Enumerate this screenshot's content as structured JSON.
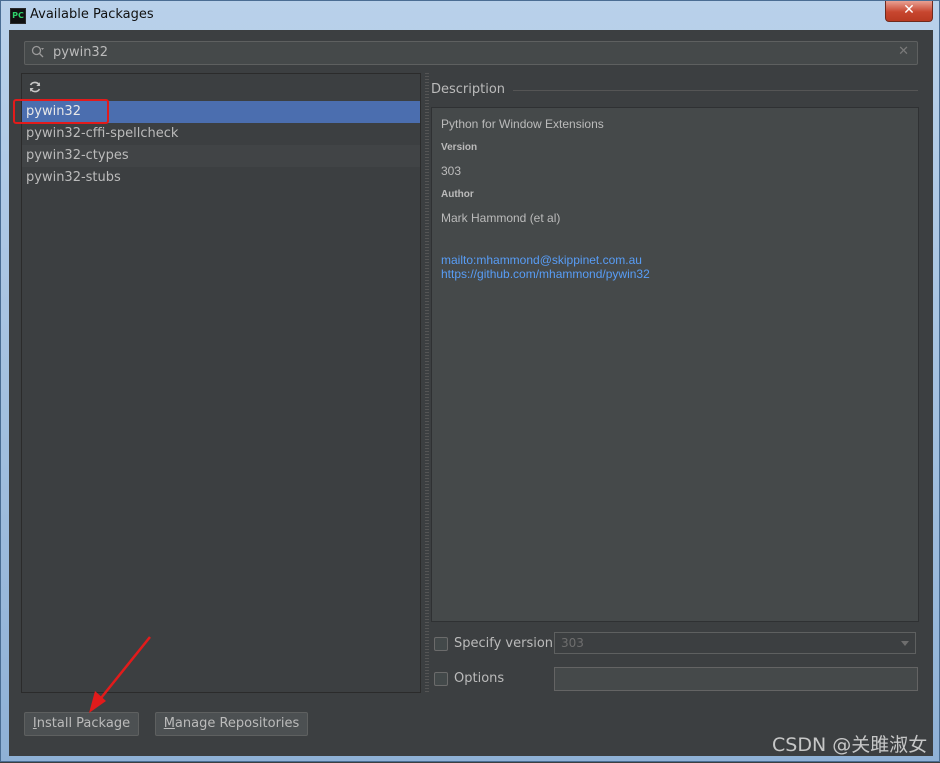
{
  "window": {
    "title": "Available Packages",
    "app_icon_text": "PC",
    "close_symbol": "✕"
  },
  "search": {
    "value": "pywin32",
    "clear_symbol": "✕"
  },
  "packages": [
    {
      "name": "pywin32",
      "selected": true
    },
    {
      "name": "pywin32-cffi-spellcheck",
      "selected": false
    },
    {
      "name": "pywin32-ctypes",
      "selected": false
    },
    {
      "name": "pywin32-stubs",
      "selected": false
    }
  ],
  "description": {
    "label": "Description",
    "summary": "Python for Window Extensions",
    "version_heading": "Version",
    "version": "303",
    "author_heading": "Author",
    "author": "Mark Hammond (et al)",
    "links": [
      "mailto:mhammond@skippinet.com.au",
      "https://github.com/mhammond/pywin32"
    ]
  },
  "options": {
    "specify_version_label": "Specify version",
    "specify_version_checked": false,
    "version_select_value": "303",
    "options_label": "Options",
    "options_checked": false,
    "options_value": ""
  },
  "buttons": {
    "install": "Install Package",
    "install_mnemonic": "I",
    "manage": "Manage Repositories",
    "manage_mnemonic": "M"
  },
  "annotations": {
    "watermark": "CSDN @关雎淑女",
    "highlight_color": "#e21b1b"
  },
  "colors": {
    "selection": "#4b6eaf",
    "link": "#589df6",
    "background": "#3c3f41"
  }
}
